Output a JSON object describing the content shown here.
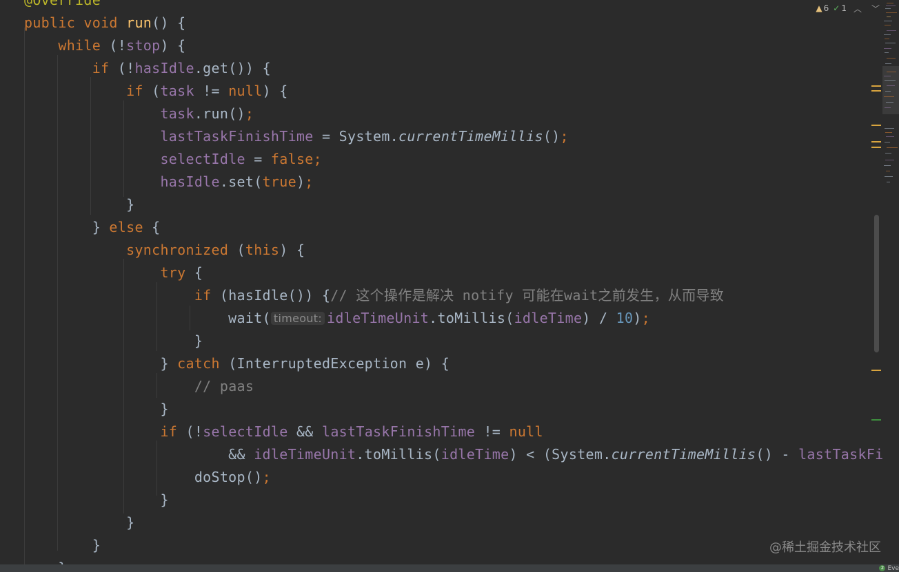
{
  "inspection": {
    "warnings_count": "6",
    "checks_count": "1",
    "warning_icon": "warning-triangle-icon",
    "check_icon": "check-mark-icon",
    "prev_icon": "chevron-up-icon",
    "next_icon": "chevron-down-icon"
  },
  "code_lines": [
    {
      "tokens": [
        {
          "t": "@Override",
          "c": "annotation"
        }
      ]
    },
    {
      "tokens": [
        {
          "t": "public",
          "c": "kw"
        },
        {
          "t": " "
        },
        {
          "t": "void",
          "c": "kw"
        },
        {
          "t": " "
        },
        {
          "t": "run",
          "c": "fn"
        },
        {
          "t": "() {"
        }
      ]
    },
    {
      "tokens": [
        {
          "t": "    "
        },
        {
          "t": "while",
          "c": "kw"
        },
        {
          "t": " (!"
        },
        {
          "t": "stop",
          "c": "field"
        },
        {
          "t": ") {"
        }
      ]
    },
    {
      "tokens": [
        {
          "t": "        "
        },
        {
          "t": "if",
          "c": "kw"
        },
        {
          "t": " (!"
        },
        {
          "t": "hasIdle",
          "c": "field"
        },
        {
          "t": ".get()) {"
        }
      ]
    },
    {
      "tokens": [
        {
          "t": "            "
        },
        {
          "t": "if",
          "c": "kw"
        },
        {
          "t": " ("
        },
        {
          "t": "task",
          "c": "field"
        },
        {
          "t": " != "
        },
        {
          "t": "null",
          "c": "kw"
        },
        {
          "t": ") {"
        }
      ]
    },
    {
      "tokens": [
        {
          "t": "                "
        },
        {
          "t": "task",
          "c": "field"
        },
        {
          "t": ".run()"
        },
        {
          "t": ";",
          "c": "kw"
        }
      ]
    },
    {
      "tokens": [
        {
          "t": "                "
        },
        {
          "t": "lastTaskFinishTime",
          "c": "field"
        },
        {
          "t": " = System."
        },
        {
          "t": "currentTimeMillis",
          "c": "static"
        },
        {
          "t": "()"
        },
        {
          "t": ";",
          "c": "kw"
        }
      ]
    },
    {
      "tokens": [
        {
          "t": "                "
        },
        {
          "t": "selectIdle",
          "c": "field"
        },
        {
          "t": " = "
        },
        {
          "t": "false",
          "c": "kw"
        },
        {
          "t": ";",
          "c": "kw"
        }
      ]
    },
    {
      "tokens": [
        {
          "t": "                "
        },
        {
          "t": "hasIdle",
          "c": "field"
        },
        {
          "t": ".set("
        },
        {
          "t": "true",
          "c": "kw"
        },
        {
          "t": ")"
        },
        {
          "t": ";",
          "c": "kw"
        }
      ]
    },
    {
      "tokens": [
        {
          "t": "            }"
        }
      ]
    },
    {
      "tokens": [
        {
          "t": "        } "
        },
        {
          "t": "else",
          "c": "kw"
        },
        {
          "t": " {"
        }
      ]
    },
    {
      "tokens": [
        {
          "t": "            "
        },
        {
          "t": "synchronized",
          "c": "kw"
        },
        {
          "t": " ("
        },
        {
          "t": "this",
          "c": "kw"
        },
        {
          "t": ") {"
        }
      ]
    },
    {
      "tokens": [
        {
          "t": "                "
        },
        {
          "t": "try",
          "c": "kw"
        },
        {
          "t": " {"
        }
      ]
    },
    {
      "tokens": [
        {
          "t": "                    "
        },
        {
          "t": "if",
          "c": "kw"
        },
        {
          "t": " (hasIdle()) {"
        },
        {
          "t": "// 这个操作是解决 notify 可能在wait之前发生，从而导致",
          "c": "comment"
        }
      ]
    },
    {
      "tokens": [
        {
          "t": "                        wait("
        },
        {
          "t": "timeout:",
          "c": "hint"
        },
        {
          "t": "idleTimeUnit",
          "c": "field"
        },
        {
          "t": ".toMillis("
        },
        {
          "t": "idleTime",
          "c": "field"
        },
        {
          "t": ") / "
        },
        {
          "t": "10",
          "c": "num"
        },
        {
          "t": ")"
        },
        {
          "t": ";",
          "c": "kw"
        }
      ]
    },
    {
      "tokens": [
        {
          "t": "                    }"
        }
      ]
    },
    {
      "tokens": [
        {
          "t": "                } "
        },
        {
          "t": "catch",
          "c": "kw"
        },
        {
          "t": " (InterruptedException e) {"
        }
      ]
    },
    {
      "tokens": [
        {
          "t": "                    "
        },
        {
          "t": "// paas",
          "c": "comment"
        }
      ]
    },
    {
      "tokens": [
        {
          "t": "                }"
        }
      ]
    },
    {
      "tokens": [
        {
          "t": "                "
        },
        {
          "t": "if",
          "c": "kw"
        },
        {
          "t": " (!"
        },
        {
          "t": "selectIdle",
          "c": "field"
        },
        {
          "t": " && "
        },
        {
          "t": "lastTaskFinishTime",
          "c": "field"
        },
        {
          "t": " != "
        },
        {
          "t": "null",
          "c": "kw"
        }
      ]
    },
    {
      "tokens": [
        {
          "t": "                        && "
        },
        {
          "t": "idleTimeUnit",
          "c": "field"
        },
        {
          "t": ".toMillis("
        },
        {
          "t": "idleTime",
          "c": "field"
        },
        {
          "t": ") < (System."
        },
        {
          "t": "currentTimeMillis",
          "c": "static"
        },
        {
          "t": "() - "
        },
        {
          "t": "lastTaskFinis",
          "c": "field"
        }
      ]
    },
    {
      "tokens": [
        {
          "t": "                    doStop()"
        },
        {
          "t": ";",
          "c": "kw"
        }
      ]
    },
    {
      "tokens": [
        {
          "t": "                }"
        }
      ]
    },
    {
      "tokens": [
        {
          "t": "            }"
        }
      ]
    },
    {
      "tokens": [
        {
          "t": "        }"
        }
      ]
    },
    {
      "tokens": [
        {
          "t": "    }"
        }
      ]
    }
  ],
  "colors": {
    "background": "#2b2b2b",
    "keyword": "#cc7832",
    "method": "#ffc66d",
    "field": "#9876aa",
    "number": "#6897bb",
    "comment": "#808080",
    "warning_mark": "#d9a53f",
    "ok_mark": "#3e8f3e"
  },
  "watermark": "@稀土掘金技术社区",
  "status_bar": {
    "event_badge": "2",
    "event_label": "Eve"
  }
}
